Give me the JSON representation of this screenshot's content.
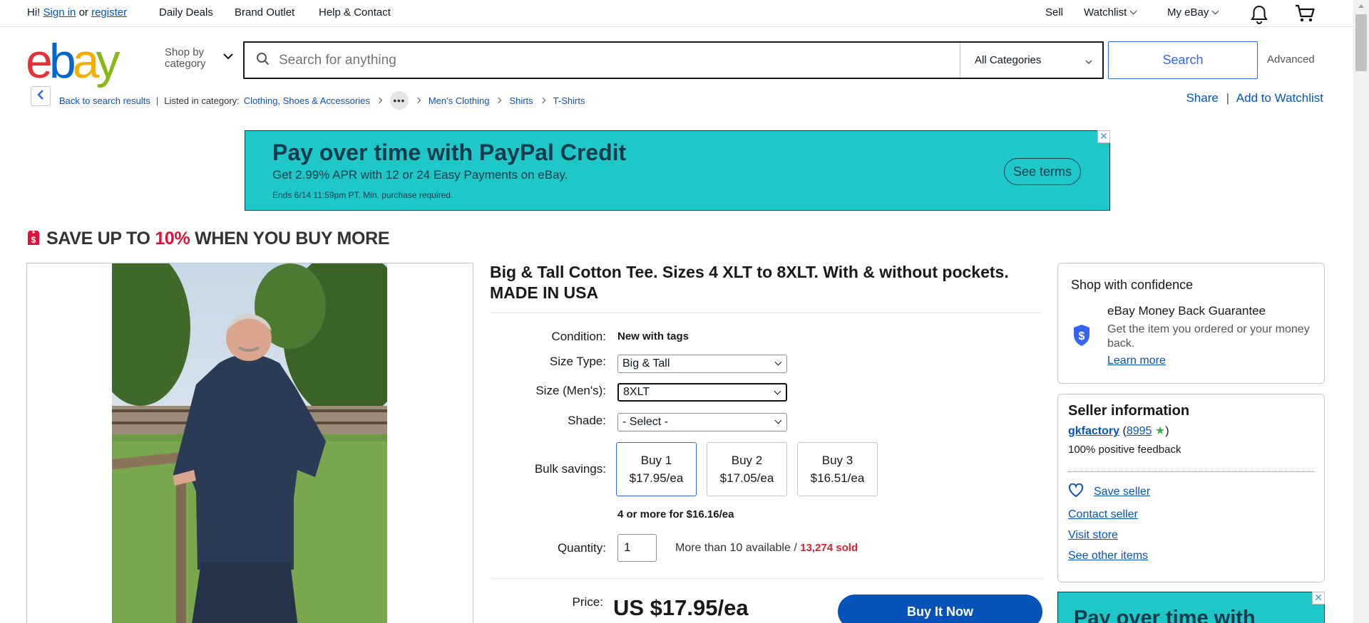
{
  "topbar": {
    "greeting": "Hi!",
    "sign_in": "Sign in",
    "or": "or",
    "register": "register",
    "daily_deals": "Daily Deals",
    "brand_outlet": "Brand Outlet",
    "help_contact": "Help & Contact",
    "sell": "Sell",
    "watchlist": "Watchlist",
    "my_ebay": "My eBay"
  },
  "header": {
    "logo_letters": [
      "e",
      "b",
      "a",
      "y"
    ],
    "logo_colors": [
      "#e53238",
      "#0064d2",
      "#f5af02",
      "#86b817"
    ],
    "shop_by_category_line1": "Shop by",
    "shop_by_category_line2": "category",
    "search_placeholder": "Search for anything",
    "category_select": "All Categories",
    "search_button": "Search",
    "advanced": "Advanced"
  },
  "breadcrumb": {
    "back": "Back to search results",
    "listed_in": "Listed in category:",
    "items": [
      "Clothing, Shoes & Accessories",
      "Men's Clothing",
      "Shirts",
      "T-Shirts"
    ],
    "share": "Share",
    "add_to_watchlist": "Add to Watchlist"
  },
  "ad": {
    "headline": "Pay over time with PayPal Credit",
    "subline": "Get 2.99% APR with 12 or 24 Easy Payments on eBay.",
    "fineprint": "Ends 6/14 11:59pm PT. Min. purchase required.",
    "cta": "See terms",
    "close": "✕",
    "color": "#1ec8c8"
  },
  "promo": {
    "prefix": "SAVE UP TO",
    "percent": "10%",
    "suffix": "WHEN YOU BUY MORE"
  },
  "product": {
    "title": "Big & Tall Cotton Tee. Sizes 4 XLT to 8XLT. With & without pockets. MADE IN USA",
    "condition_label": "Condition:",
    "condition_value": "New with tags",
    "size_type_label": "Size Type:",
    "size_type_value": "Big & Tall",
    "size_label": "Size (Men's):",
    "size_value": "8XLT",
    "shade_label": "Shade:",
    "shade_value": "- Select -",
    "bulk_label": "Bulk savings:",
    "bulk_options": [
      {
        "qty": "Buy 1",
        "price": "$17.95/ea"
      },
      {
        "qty": "Buy 2",
        "price": "$17.05/ea"
      },
      {
        "qty": "Buy 3",
        "price": "$16.51/ea"
      }
    ],
    "bulk_more": "4 or more for $16.16/ea",
    "quantity_label": "Quantity:",
    "quantity_value": "1",
    "availability": "More than 10 available /",
    "sold": "13,274 sold",
    "price_label": "Price:",
    "price": "US $17.95/ea",
    "buy_now": "Buy It Now"
  },
  "confidence": {
    "title": "Shop with confidence",
    "guarantee_title": "eBay Money Back Guarantee",
    "guarantee_text": "Get the item you ordered or your money back.",
    "learn_more": "Learn more"
  },
  "seller": {
    "title": "Seller information",
    "name": "gkfactory",
    "feedback_count": "8995",
    "positive": "100% positive feedback",
    "save_seller": "Save seller",
    "contact": "Contact seller",
    "visit_store": "Visit store",
    "other_items": "See other items"
  },
  "ad2": {
    "headline": "Pay over time with"
  }
}
